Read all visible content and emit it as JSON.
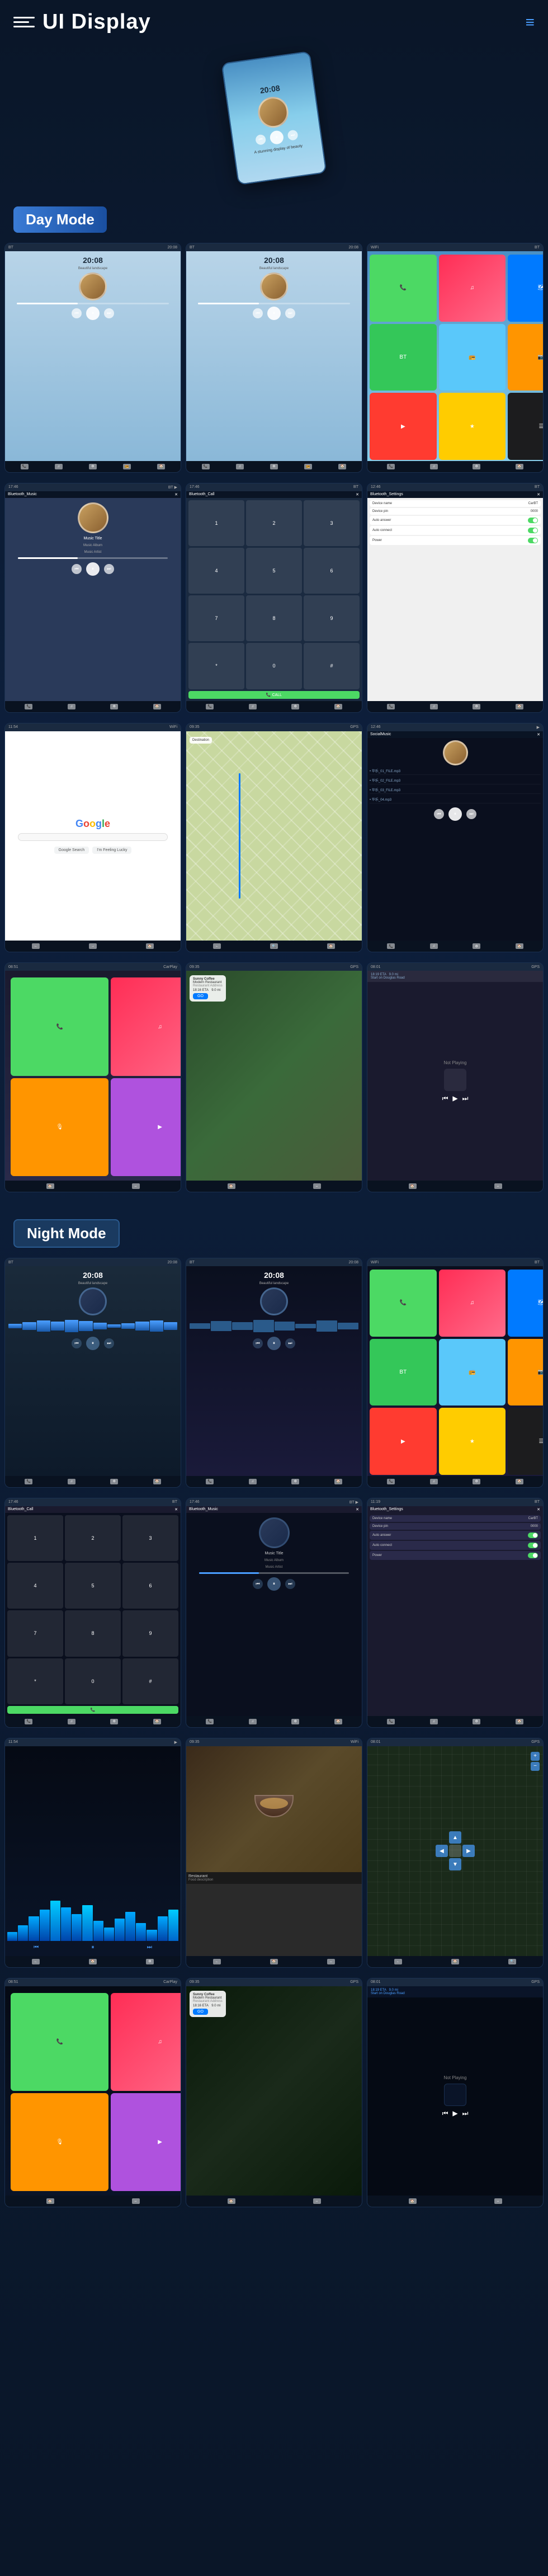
{
  "header": {
    "title": "UI Display",
    "menu_icon": "≡",
    "nav_icon": "≡"
  },
  "sections": {
    "day_mode": {
      "label": "Day Mode"
    },
    "night_mode": {
      "label": "Night Mode"
    }
  },
  "hero": {
    "time": "20:08",
    "subtitle": "A stunning display of beauty"
  },
  "day_screens": {
    "row1": [
      {
        "type": "music_day",
        "time": "20:08",
        "desc": "Music Home Day 1"
      },
      {
        "type": "music_day2",
        "time": "20:08",
        "desc": "Music Home Day 2"
      },
      {
        "type": "apps_day",
        "desc": "Apps Grid Day"
      }
    ],
    "row2": [
      {
        "type": "bt_music",
        "title": "Bluetooth_Music",
        "track": "Music Title",
        "album": "Music Album",
        "artist": "Music Artist"
      },
      {
        "type": "bt_call",
        "title": "Bluetooth_Call"
      },
      {
        "type": "bt_settings",
        "title": "Bluetooth_Settings",
        "rows": [
          {
            "label": "Device name",
            "value": "CarBT"
          },
          {
            "label": "Device pin",
            "value": "0000"
          },
          {
            "label": "Auto answer"
          },
          {
            "label": "Auto connect"
          },
          {
            "label": "Power"
          }
        ]
      }
    ],
    "row3": [
      {
        "type": "google",
        "desc": "Google Search"
      },
      {
        "type": "map_nav",
        "desc": "Navigation Map"
      },
      {
        "type": "local_music",
        "desc": "Local Music",
        "items": [
          "华乐_01_FILE.mp3",
          "华乐_02_FILE.mp3",
          "华乐_03_FILE.mp3",
          "华乐_04.mp3"
        ]
      }
    ],
    "row4": [
      {
        "type": "carplay_home",
        "desc": "CarPlay Home"
      },
      {
        "type": "carplay_nav",
        "desc": "CarPlay Navigation",
        "restaurant": "Sunny Coffee Modern Restaurant",
        "eta": "18:16 ETA",
        "distance": "9.0 mi",
        "go": "GO"
      },
      {
        "type": "carplay_np",
        "desc": "CarPlay Now Playing",
        "route": "Start on Douglas Road",
        "not_playing": "Not Playing"
      }
    ]
  },
  "night_screens": {
    "row1": [
      {
        "type": "music_night1",
        "time": "20:08",
        "desc": "Music Home Night 1"
      },
      {
        "type": "music_night2",
        "time": "20:08",
        "desc": "Music Home Night 2"
      },
      {
        "type": "apps_night",
        "desc": "Apps Grid Night"
      }
    ],
    "row2": [
      {
        "type": "bt_call_night",
        "title": "Bluetooth_Call"
      },
      {
        "type": "bt_music_night",
        "title": "Bluetooth_Music",
        "track": "Music Title",
        "album": "Music Album",
        "artist": "Music Artist"
      },
      {
        "type": "bt_settings_night",
        "title": "Bluetooth_Settings",
        "rows": [
          {
            "label": "Device name",
            "value": "CarBT"
          },
          {
            "label": "Device pin",
            "value": "0000"
          },
          {
            "label": "Auto answer"
          },
          {
            "label": "Auto connect"
          },
          {
            "label": "Power"
          }
        ]
      }
    ],
    "row3": [
      {
        "type": "viz_night",
        "desc": "Audio Visualizer Night"
      },
      {
        "type": "food_screen",
        "desc": "Food/Restaurant Screen"
      },
      {
        "type": "map_night",
        "desc": "Map Night"
      }
    ],
    "row4": [
      {
        "type": "carplay_home_night",
        "desc": "CarPlay Home Night"
      },
      {
        "type": "carplay_nav_night",
        "desc": "CarPlay Navigation Night",
        "restaurant": "Sunny Coffee Modern Restaurant",
        "eta": "18:16 ETA",
        "distance": "9.0 mi",
        "go": "GO"
      },
      {
        "type": "carplay_np_night",
        "desc": "CarPlay Now Playing Night",
        "route": "Start on Douglas Road",
        "not_playing": "Not Playing"
      }
    ]
  },
  "labels": {
    "music_album": "Music Album",
    "music_artist": "Music Artist"
  }
}
